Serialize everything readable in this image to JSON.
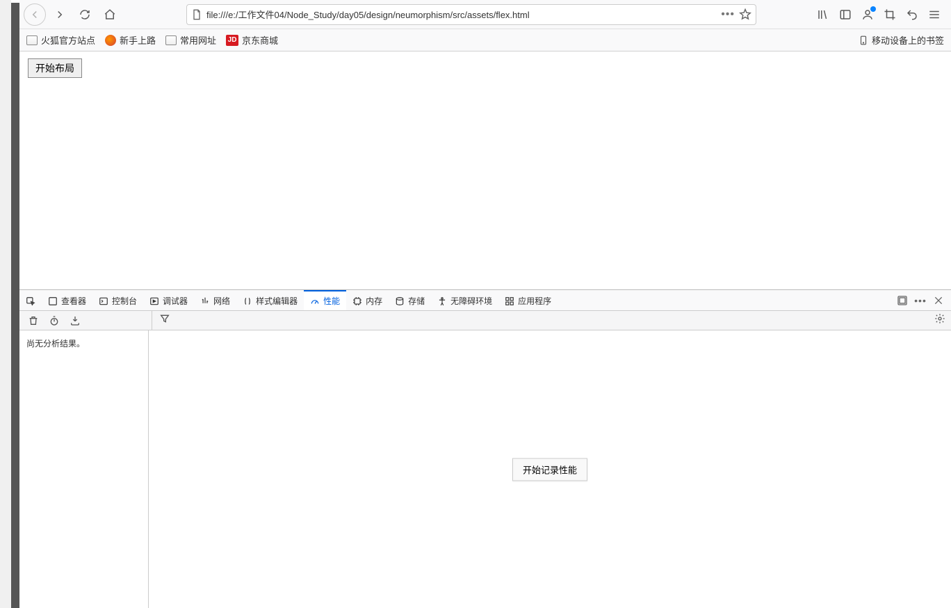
{
  "url": "file:///e:/工作文件04/Node_Study/day05/design/neumorphism/src/assets/flex.html",
  "bookmarks": {
    "items": [
      {
        "label": "火狐官方站点",
        "iconType": "folder"
      },
      {
        "label": "新手上路",
        "iconType": "firefox"
      },
      {
        "label": "常用网址",
        "iconType": "folder"
      },
      {
        "label": "京东商城",
        "iconType": "jd",
        "badge": "JD"
      }
    ],
    "mobile": "移动设备上的书签"
  },
  "page": {
    "buttonLabel": "开始布局"
  },
  "devtools": {
    "tabs": {
      "inspector": "查看器",
      "console": "控制台",
      "debugger": "调试器",
      "network": "网络",
      "styleeditor": "样式编辑器",
      "performance": "性能",
      "memory": "内存",
      "storage": "存储",
      "accessibility": "无障碍环境",
      "application": "应用程序"
    },
    "sidebarMsg": "尚无分析结果。",
    "recordButton": "开始记录性能"
  }
}
